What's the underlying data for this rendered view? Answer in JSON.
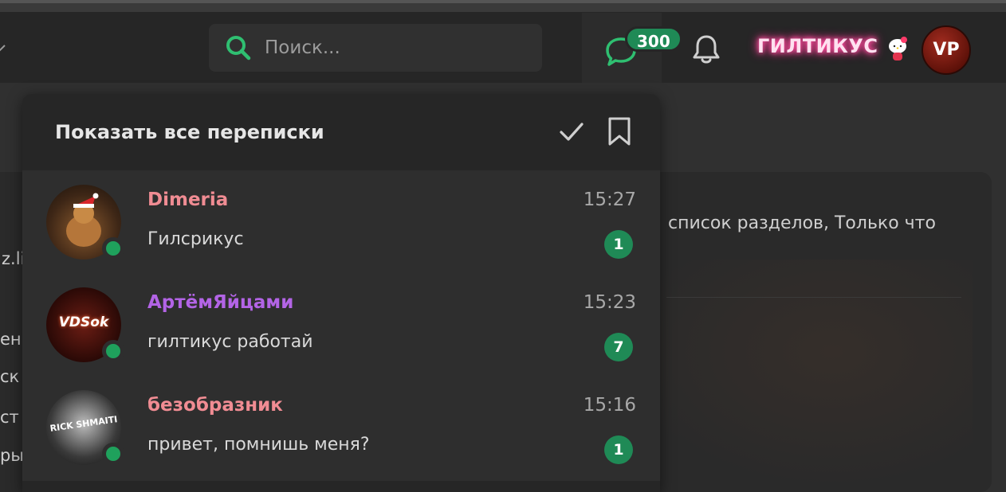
{
  "header": {
    "search": {
      "placeholder": "Поиск..."
    },
    "messages_badge": "300",
    "username": "ГИЛТИКУС",
    "avatar_text": "VP"
  },
  "conversations_popup": {
    "title": "Показать все переписки",
    "items": [
      {
        "name": "Dimeria",
        "name_color": "#f08c93",
        "time": "15:27",
        "preview": "Гилсрикус",
        "unread": "1",
        "avatar_text": ""
      },
      {
        "name": "АртёмЯйцами",
        "name_color": "#b364e6",
        "time": "15:23",
        "preview": "гилтикус работай",
        "unread": "7",
        "avatar_text": "VDSok"
      },
      {
        "name": "безобразник",
        "name_color": "#f08c93",
        "time": "15:16",
        "preview": "привет, помнишь меня?",
        "unread": "1",
        "avatar_text": "RICK SHMAITI"
      }
    ]
  },
  "background": {
    "snippet": "список разделов, Только что",
    "left_fragments": [
      "z.li",
      "ен",
      "ск",
      "ст",
      "ры"
    ]
  },
  "colors": {
    "accent_green": "#1f8a56",
    "online_green": "#1fa15c",
    "search_icon": "#2fbf71"
  }
}
